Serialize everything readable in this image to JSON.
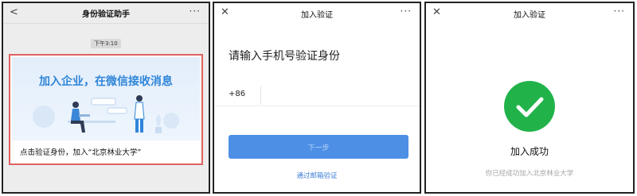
{
  "panel1": {
    "title": "身份验证助手",
    "back_glyph": "<",
    "more_glyph": "···",
    "time": "下午3:10",
    "card_headline": "加入企业，在微信接收消息",
    "card_caption": "点击验证身份，加入“北京林业大学”"
  },
  "panel2": {
    "title": "加入验证",
    "close_glyph": "✕",
    "more_glyph": "···",
    "prompt": "请输入手机号验证身份",
    "country_code": "+86",
    "phone_value": "",
    "next_label": "下一步",
    "email_link": "通过邮箱验证"
  },
  "panel3": {
    "title": "加入验证",
    "close_glyph": "✕",
    "more_glyph": "···",
    "success_title": "加入成功",
    "success_subtitle": "你已经成功加入北京林业大学"
  },
  "colors": {
    "accent_blue": "#4e8fe6",
    "success_green": "#21b34a",
    "highlight_red": "#e06060"
  }
}
